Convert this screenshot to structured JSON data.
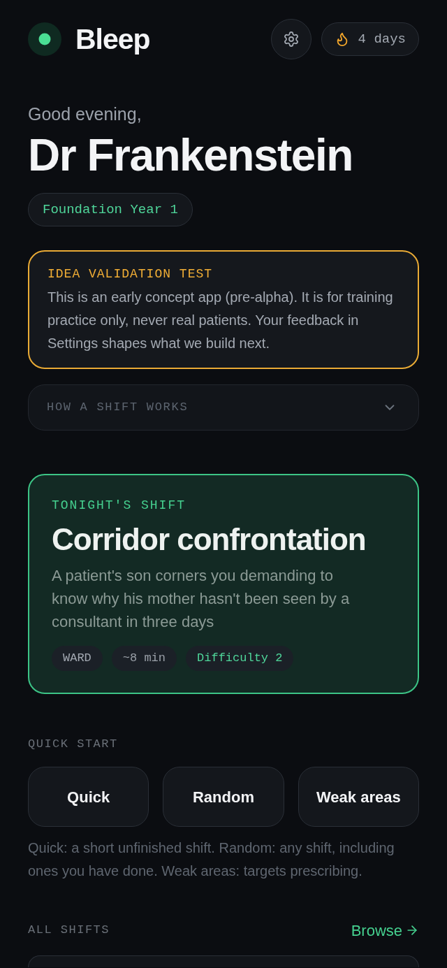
{
  "header": {
    "logo_text": "Bleep",
    "streak": {
      "label": "4 days"
    }
  },
  "greeting": "Good evening,",
  "name": "Dr Frankenstein",
  "grade_badge": "Foundation Year 1",
  "notice": {
    "title": "IDEA VALIDATION TEST",
    "body": "This is an early concept app (pre-alpha). It is for training practice only, never real patients. Your feedback in Settings shapes what we build next."
  },
  "how_it_works": {
    "label": "HOW A SHIFT WORKS",
    "expanded": false
  },
  "tonights_shift": {
    "label": "TONIGHT'S SHIFT",
    "title": "Corridor confrontation",
    "description": "A patient's son corners you demanding to know why his mother hasn't been seen by a consultant in three days",
    "tags": [
      {
        "text": "WARD",
        "kind": "setting"
      },
      {
        "text": "~8 min",
        "kind": "duration"
      },
      {
        "text": "Difficulty 2",
        "kind": "difficulty"
      }
    ]
  },
  "quick_start": {
    "label": "QUICK START",
    "buttons": [
      "Quick",
      "Random",
      "Weak areas"
    ],
    "help": "Quick: a short unfinished shift. Random: any shift, including ones you have done. Weak areas: targets prescribing."
  },
  "all_shifts": {
    "label": "ALL SHIFTS",
    "link": "Browse"
  }
}
